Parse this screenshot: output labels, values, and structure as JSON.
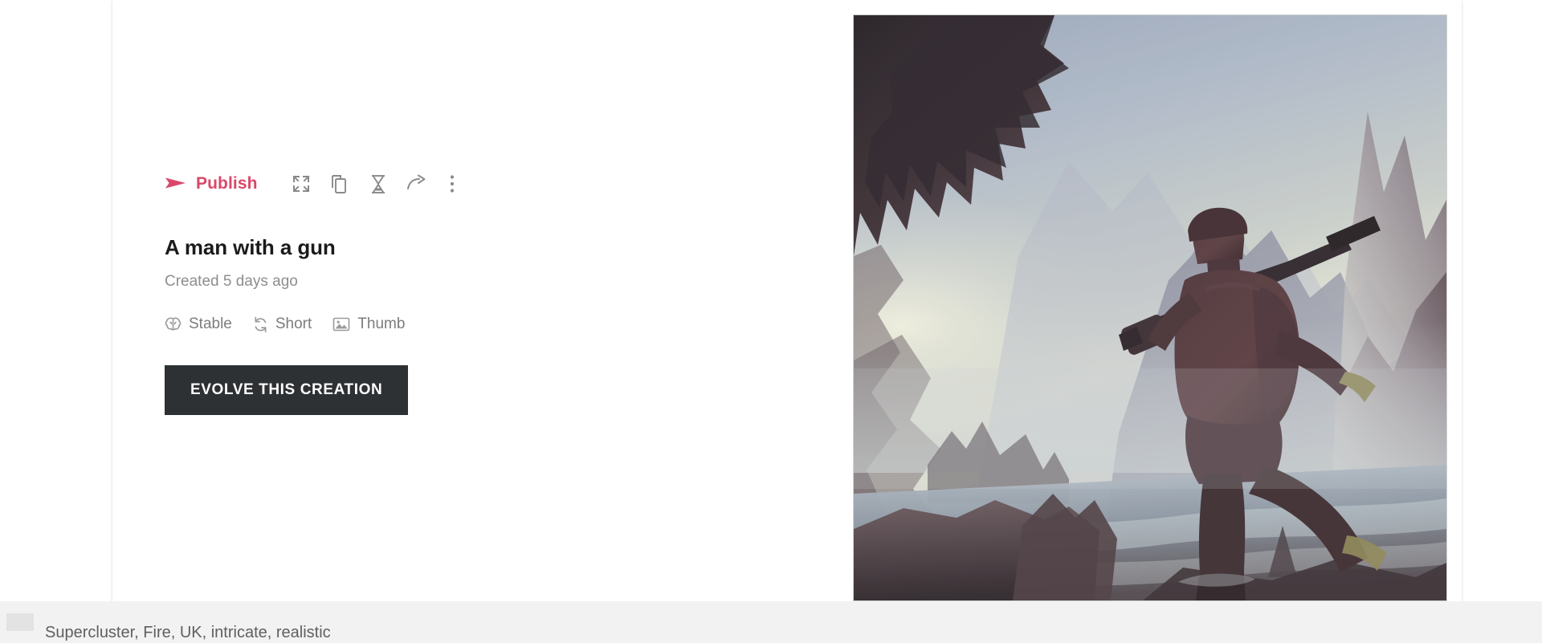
{
  "theme": {
    "accent": "#d9486a",
    "cta_background": "#2e3133",
    "cta_text": "#ffffff",
    "card_background": "#ffffff",
    "page_background": "#ffffff",
    "muted_text": "#8e8e8e",
    "title_text": "#1b1b1b",
    "strip_background": "#f2f2f2"
  },
  "toolbar": {
    "publish_label": "Publish",
    "publish_icon": "send-icon",
    "actions": [
      {
        "name": "expand-icon",
        "title": "Expand"
      },
      {
        "name": "duplicate-icon",
        "title": "Duplicate"
      },
      {
        "name": "hourglass-icon",
        "title": "History"
      },
      {
        "name": "share-icon",
        "title": "Share"
      },
      {
        "name": "more-vertical-icon",
        "title": "More options"
      }
    ]
  },
  "creation": {
    "title": "A man with a gun",
    "created": "Created 5 days ago",
    "attributes": [
      {
        "icon": "brain-icon",
        "label": "Stable"
      },
      {
        "icon": "refresh-icon",
        "label": "Short"
      },
      {
        "icon": "image-icon",
        "label": "Thumb"
      }
    ],
    "cta_label": "EVOLVE THIS CREATION"
  },
  "artwork": {
    "alt": "Silhouetted soldier with a rifle running through a misty mountain canyon",
    "palette": {
      "sky_pale": "#e8e9d9",
      "sky_blue": "#aab4c4",
      "mountain_far": "#b8bcc6",
      "mountain_mid": "#8e8e9c",
      "cave_dark": "#2a2329",
      "figure": "#4a3336",
      "water": "#9aa6b4"
    }
  },
  "prompt_strip": {
    "text": "Supercluster, Fire, UK, intricate, realistic"
  }
}
